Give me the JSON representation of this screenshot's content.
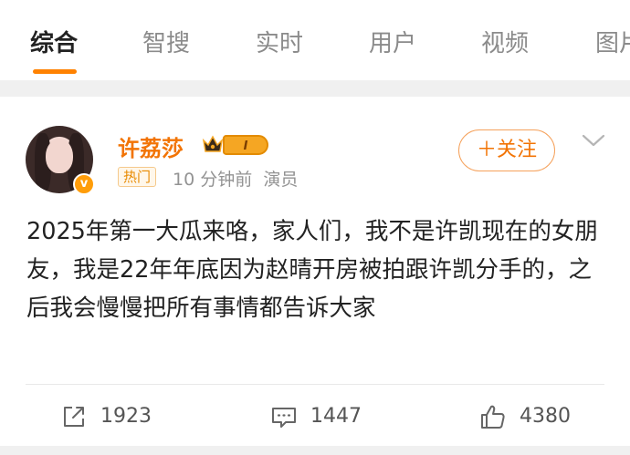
{
  "tabs": [
    {
      "label": "综合"
    },
    {
      "label": "智搜"
    },
    {
      "label": "实时"
    },
    {
      "label": "用户"
    },
    {
      "label": "视频"
    },
    {
      "label": "图片"
    }
  ],
  "post": {
    "username": "许荔莎",
    "level": "I",
    "verified_mark": "v",
    "hot_tag": "热门",
    "time": "10 分钟前",
    "role": "演员",
    "follow_label": "＋关注",
    "text": "2025年第一大瓜来咯，家人们，我不是许凯现在的女朋友，我是22年年底因为赵晴开房被拍跟许凯分手的，之后我会慢慢把所有事情都告诉大家"
  },
  "actions": {
    "repost_count": "1923",
    "comment_count": "1447",
    "like_count": "4380"
  },
  "colors": {
    "accent": "#ff8200",
    "username": "#f27405",
    "background_gap": "#f0f0f0"
  },
  "icons": [
    "crown-icon",
    "repost-icon",
    "comment-icon",
    "like-icon",
    "chevron-down-icon"
  ]
}
